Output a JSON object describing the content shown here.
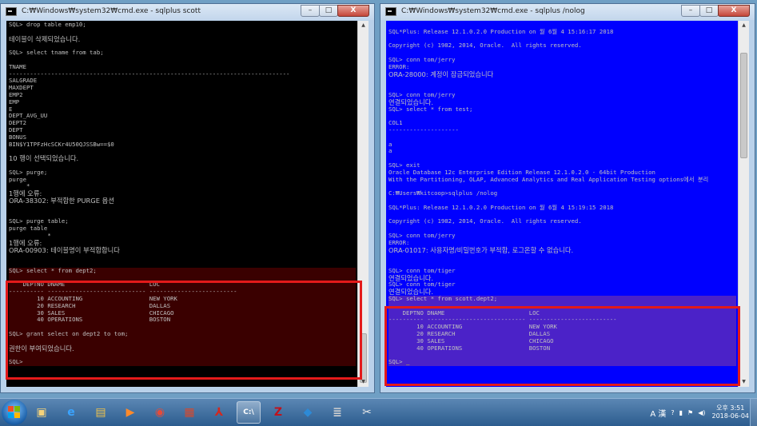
{
  "left_window": {
    "title": "C:₩Windows₩system32₩cmd.exe - sqlplus  scott",
    "lines": [
      {
        "t": "SQL> drop table emp10;"
      },
      {
        "t": ""
      },
      {
        "t": "테이블이 삭제되었습니다.",
        "kr": true
      },
      {
        "t": ""
      },
      {
        "t": "SQL> select tname from tab;"
      },
      {
        "t": ""
      },
      {
        "t": "TNAME"
      },
      {
        "t": "--------------------------------------------------------------------------------"
      },
      {
        "t": "SALGRADE"
      },
      {
        "t": "MAXDEPT"
      },
      {
        "t": "EMP2"
      },
      {
        "t": "EMP"
      },
      {
        "t": "E"
      },
      {
        "t": "DEPT_AVG_UU"
      },
      {
        "t": "DEPT2"
      },
      {
        "t": "DEPT"
      },
      {
        "t": "BONUS"
      },
      {
        "t": "BIN$Y1TPFzHcSCKr4U50QJSSBw==$0"
      },
      {
        "t": ""
      },
      {
        "t": "10 행이 선택되었습니다.",
        "kr": true
      },
      {
        "t": ""
      },
      {
        "t": "SQL> purge;"
      },
      {
        "t": "purge"
      },
      {
        "t": "     *"
      },
      {
        "t": "1행에 오류:",
        "kr": true
      },
      {
        "t": "ORA-38302: 부적합한 PURGE 옵션",
        "kr": true
      },
      {
        "t": ""
      },
      {
        "t": ""
      },
      {
        "t": "SQL> purge table;"
      },
      {
        "t": "purge table"
      },
      {
        "t": "           *"
      },
      {
        "t": "1행에 오류:",
        "kr": true
      },
      {
        "t": "ORA-00903: 테이블명이 부적합합니다",
        "kr": true
      },
      {
        "t": ""
      },
      {
        "t": ""
      },
      {
        "t": "SQL> select * from dept2;"
      },
      {
        "t": ""
      },
      {
        "t": "    DEPTNO DNAME                        LOC"
      },
      {
        "t": "---------- ---------------------------- -------------------------"
      },
      {
        "t": "        10 ACCOUNTING                   NEW YORK"
      },
      {
        "t": "        20 RESEARCH                     DALLAS"
      },
      {
        "t": "        30 SALES                        CHICAGO"
      },
      {
        "t": "        40 OPERATIONS                   BOSTON"
      },
      {
        "t": ""
      },
      {
        "t": "SQL> grant select on dept2 to tom;"
      },
      {
        "t": ""
      },
      {
        "t": "권한이 부여되었습니다.",
        "kr": true
      },
      {
        "t": ""
      },
      {
        "t": "SQL>"
      }
    ]
  },
  "right_window": {
    "title": "C:₩Windows₩system32₩cmd.exe - sqlplus  /nolog",
    "lines": [
      {
        "t": ""
      },
      {
        "t": "SQL*Plus: Release 12.1.0.2.0 Production on 월 6월 4 15:16:17 2018"
      },
      {
        "t": ""
      },
      {
        "t": "Copyright (c) 1982, 2014, Oracle.  All rights reserved."
      },
      {
        "t": ""
      },
      {
        "t": "SQL> conn tom/jerry"
      },
      {
        "t": "ERROR:"
      },
      {
        "t": "ORA-28000: 계정이 잠금되었습니다",
        "kr": true
      },
      {
        "t": ""
      },
      {
        "t": ""
      },
      {
        "t": "SQL> conn tom/jerry"
      },
      {
        "t": "연결되었습니다.",
        "kr": true
      },
      {
        "t": "SQL> select * from test;"
      },
      {
        "t": ""
      },
      {
        "t": "COL1"
      },
      {
        "t": "--------------------"
      },
      {
        "t": ""
      },
      {
        "t": "a"
      },
      {
        "t": "a"
      },
      {
        "t": ""
      },
      {
        "t": "SQL> exit"
      },
      {
        "t": "Oracle Database 12c Enterprise Edition Release 12.1.0.2.0 - 64bit Production"
      },
      {
        "t": "With the Partitioning, OLAP, Advanced Analytics and Real Application Testing options에서 분리"
      },
      {
        "t": ""
      },
      {
        "t": "C:₩Users₩kitcoop>sqlplus /nolog"
      },
      {
        "t": ""
      },
      {
        "t": "SQL*Plus: Release 12.1.0.2.0 Production on 월 6월 4 15:19:15 2018"
      },
      {
        "t": ""
      },
      {
        "t": "Copyright (c) 1982, 2014, Oracle.  All rights reserved."
      },
      {
        "t": ""
      },
      {
        "t": "SQL> conn tom/jerry"
      },
      {
        "t": "ERROR:"
      },
      {
        "t": "ORA-01017: 사용자명/비밀번호가 부적합, 로그온할 수 없습니다.",
        "kr": true
      },
      {
        "t": ""
      },
      {
        "t": ""
      },
      {
        "t": "SQL> conn tom/tiger"
      },
      {
        "t": "연결되었습니다.",
        "kr": true
      },
      {
        "t": "SQL> conn tom/tiger"
      },
      {
        "t": "연결되었습니다.",
        "kr": true
      },
      {
        "t": "SQL> select * from scott.dept2;"
      },
      {
        "t": ""
      },
      {
        "t": "    DEPTNO DNAME                        LOC"
      },
      {
        "t": "---------- ---------------------------- -------------------------"
      },
      {
        "t": "        10 ACCOUNTING                   NEW YORK"
      },
      {
        "t": "        20 RESEARCH                     DALLAS"
      },
      {
        "t": "        30 SALES                        CHICAGO"
      },
      {
        "t": "        40 OPERATIONS                   BOSTON"
      },
      {
        "t": ""
      },
      {
        "t": "SQL> _"
      }
    ]
  },
  "window_controls": {
    "minimize": "–",
    "maximize": "□",
    "close": "X"
  },
  "colors": {
    "left_console_bg": "#000000",
    "left_console_fg": "#c0c0c0",
    "left_highlight_bg": "#3a0000",
    "right_console_bg": "#0000ff",
    "right_console_fg": "#c0c0c0",
    "right_highlight_bg": "#4b22c8",
    "annotation_box": "#e31a1a",
    "cursor": "#ffff00"
  },
  "taskbar": {
    "apps": [
      {
        "name": "windows-explorer-icon",
        "glyph": "▣",
        "color": "#f4d37b"
      },
      {
        "name": "ie-icon",
        "glyph": "e",
        "color": "#3aa4ff"
      },
      {
        "name": "folder-icon",
        "glyph": "▤",
        "color": "#f0c24b"
      },
      {
        "name": "media-player-icon",
        "glyph": "▶",
        "color": "#ff8a2a"
      },
      {
        "name": "chrome-icon",
        "glyph": "◉",
        "color": "#e44b3a"
      },
      {
        "name": "presentation-icon",
        "glyph": "▦",
        "color": "#d9482b"
      },
      {
        "name": "pdf-icon",
        "glyph": "⅄",
        "color": "#d2281f"
      },
      {
        "name": "cmd-icon",
        "glyph": "C:\\",
        "color": "#ffffff"
      },
      {
        "name": "filezilla-icon",
        "glyph": "Z",
        "color": "#c0121c"
      },
      {
        "name": "vscode-icon",
        "glyph": "◆",
        "color": "#2d8ad6"
      },
      {
        "name": "db-tool-icon",
        "glyph": "≣",
        "color": "#cfcfcf"
      },
      {
        "name": "snipping-tool-icon",
        "glyph": "✂",
        "color": "#e9e9e9"
      }
    ],
    "tray": {
      "ime": "A 漢",
      "clock_time": "오후 3:51",
      "clock_date": "2018-06-04"
    }
  }
}
